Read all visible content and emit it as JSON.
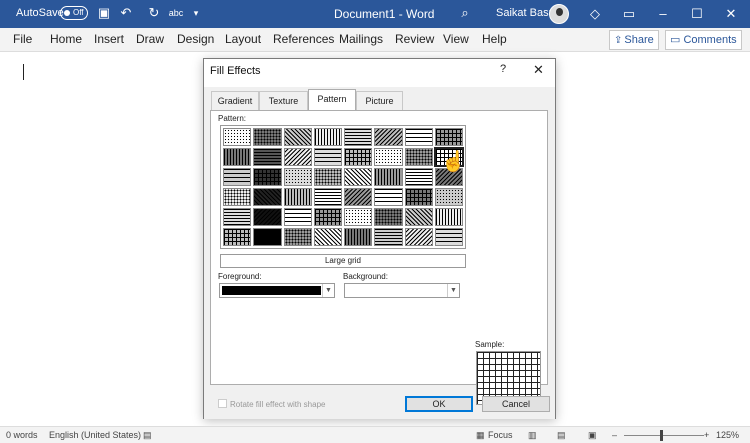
{
  "titlebar": {
    "autosave_label": "AutoSave",
    "autosave_state": "Off",
    "document_title": "Document1 - Word",
    "user_name": "Saikat Basu",
    "accent": "#2b579a"
  },
  "menu": {
    "items": [
      "File",
      "Home",
      "Insert",
      "Draw",
      "Design",
      "Layout",
      "References",
      "Mailings",
      "Review",
      "View",
      "Help"
    ],
    "share_label": "Share",
    "comments_label": "Comments"
  },
  "dialog": {
    "title": "Fill Effects",
    "help": "?",
    "close": "✕",
    "tabs": [
      "Gradient",
      "Texture",
      "Pattern",
      "Picture"
    ],
    "active_tab": "Pattern",
    "pattern_label": "Pattern:",
    "selected_pattern": "Large grid",
    "foreground_label": "Foreground:",
    "background_label": "Background:",
    "foreground_color": "#000000",
    "background_color": "#ffffff",
    "sample_label": "Sample:",
    "rotate_label": "Rotate fill effect with shape",
    "ok_label": "OK",
    "cancel_label": "Cancel"
  },
  "statusbar": {
    "words": "0 words",
    "language": "English (United States)",
    "focus": "Focus",
    "zoom": "125%"
  }
}
